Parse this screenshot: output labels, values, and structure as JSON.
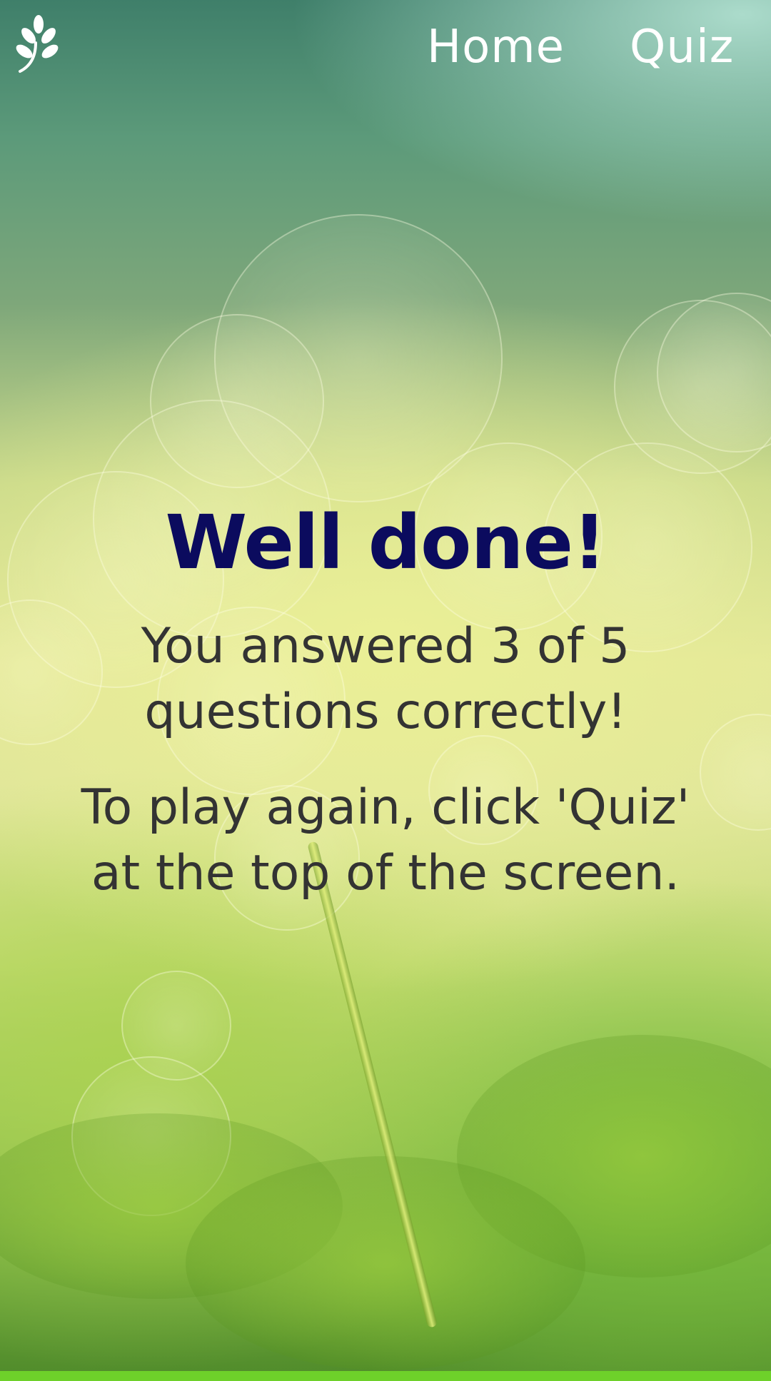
{
  "navbar": {
    "logo_icon": "leaf-sprig-icon",
    "links": [
      {
        "label": "Home"
      },
      {
        "label": "Quiz"
      }
    ]
  },
  "results": {
    "heading": "Well done!",
    "score_text": "You answered 3 of 5 questions correctly!",
    "score": {
      "correct": 3,
      "total": 5
    },
    "instruction_text": "To play again, click 'Quiz' at the top of the screen."
  },
  "colors": {
    "heading": "#0b0b5e",
    "body_text": "#333333",
    "nav_text": "#ffffff",
    "bottom_bar": "#6ed12a"
  }
}
